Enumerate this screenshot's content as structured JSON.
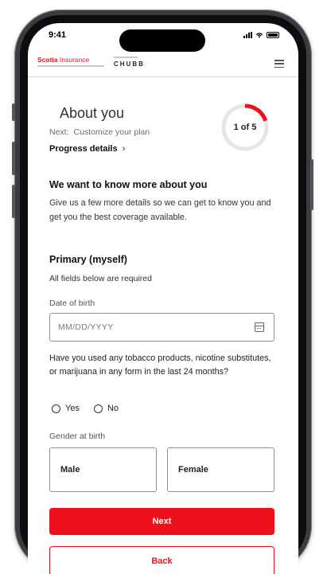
{
  "status_bar": {
    "time": "9:41"
  },
  "header": {
    "brand_primary": "Scotia",
    "brand_secondary": "Insurance",
    "partner_brand": "CHUBB"
  },
  "step": {
    "title": "About you",
    "next_label": "Next:",
    "next_value": "Customize your plan",
    "progress_link": "Progress details",
    "progress_link_chevron": "›",
    "counter": "1 of 5",
    "progress_fraction": 0.2
  },
  "intro": {
    "heading": "We want to know more about you",
    "body": "Give us a few more details so we can get to know you and get you the best coverage available."
  },
  "primary": {
    "heading": "Primary (myself)",
    "required_note": "All fields below are required"
  },
  "dob": {
    "label": "Date of birth",
    "placeholder": "MM/DD/YYYY",
    "value": ""
  },
  "tobacco": {
    "question": "Have you used any tobacco products, nicotine substitutes, or marijuana in any form in the last 24 months?",
    "options": [
      "Yes",
      "No"
    ]
  },
  "gender": {
    "label": "Gender at birth",
    "options": [
      "Male",
      "Female"
    ]
  },
  "actions": {
    "next": "Next",
    "back": "Back"
  },
  "colors": {
    "accent": "#ec111a",
    "ring_track": "#e6e6e6",
    "frame": "#3b3b40"
  }
}
